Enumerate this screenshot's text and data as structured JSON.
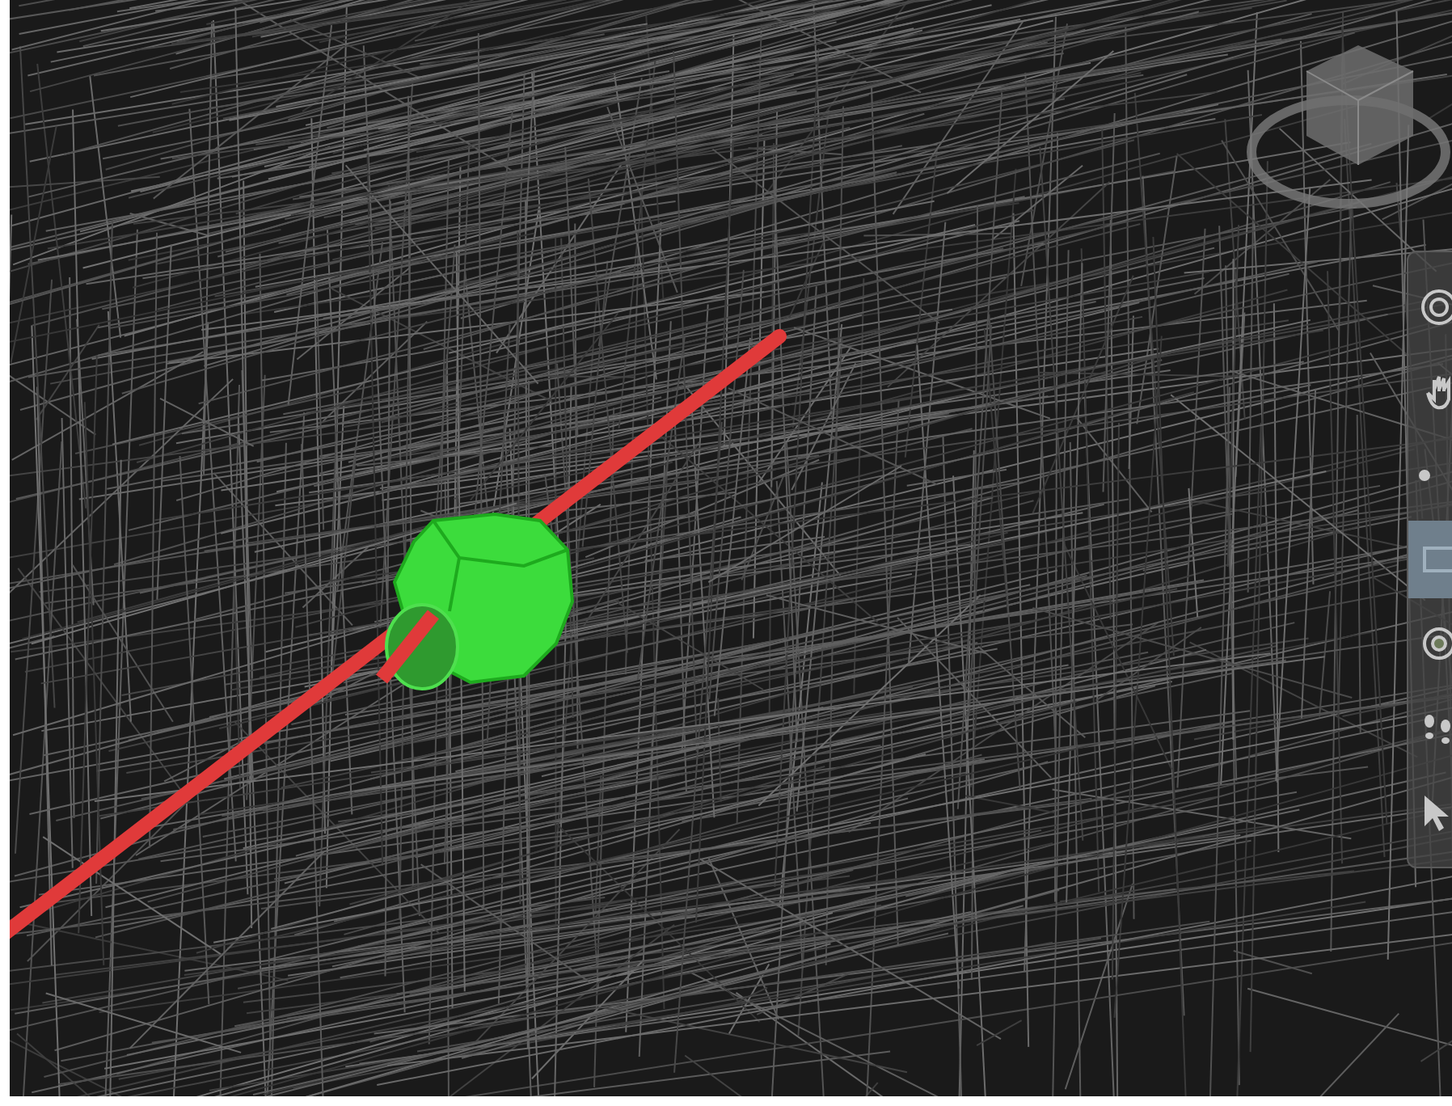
{
  "viewer": {
    "toolbar": {
      "tools": [
        {
          "kind": "orbit",
          "selected": false
        },
        {
          "kind": "pan",
          "selected": false
        },
        {
          "kind": "zoom",
          "selected": false
        },
        {
          "kind": "fit",
          "selected": true
        },
        {
          "kind": "look",
          "selected": false
        },
        {
          "kind": "walk",
          "selected": false
        },
        {
          "kind": "select",
          "selected": false
        }
      ]
    }
  }
}
